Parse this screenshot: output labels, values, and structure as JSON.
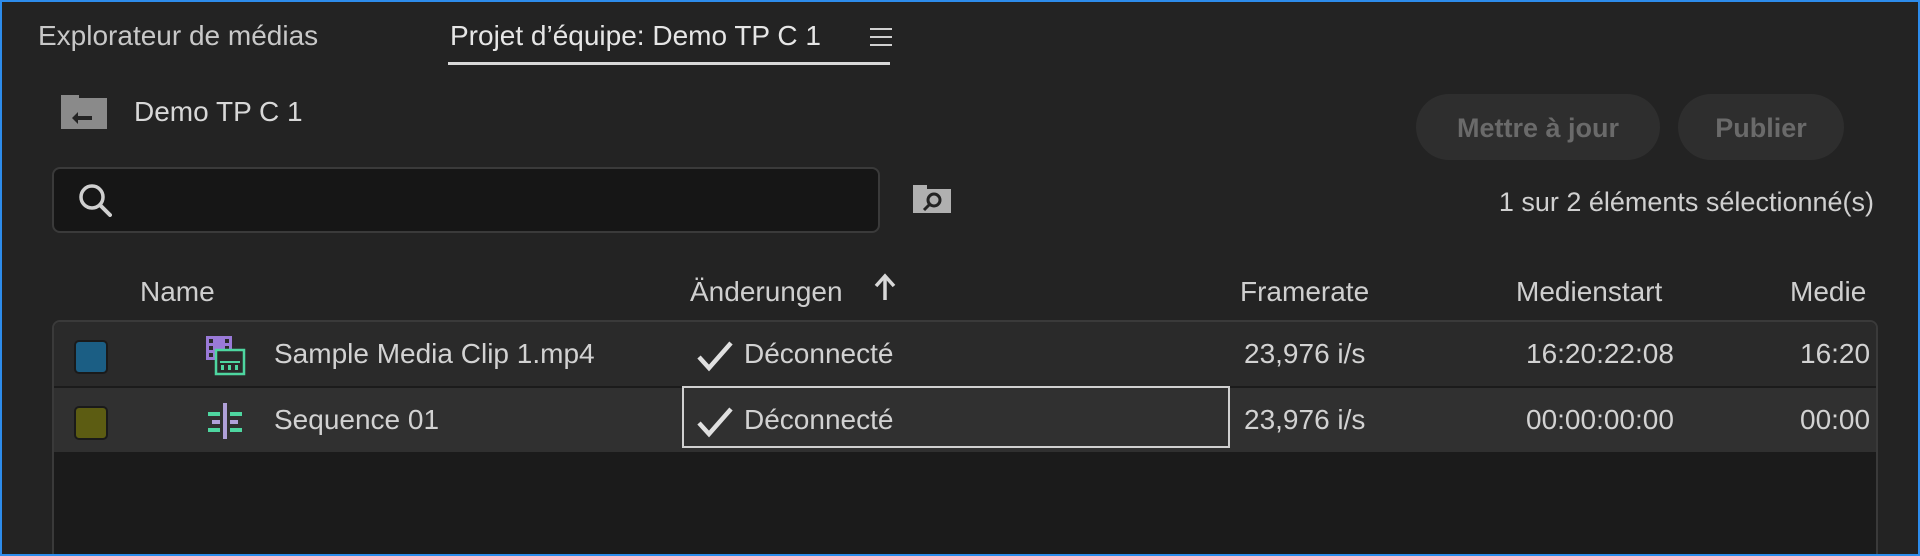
{
  "tabs": [
    {
      "label": "Explorateur de médias"
    },
    {
      "label": "Projet d’équipe: Demo TP C 1"
    }
  ],
  "project": {
    "name": "Demo TP C 1"
  },
  "buttons": {
    "update": "Mettre à jour",
    "publish": "Publier"
  },
  "search": {
    "value": "",
    "placeholder": ""
  },
  "status": {
    "selection": "1 sur 2 éléments sélectionné(s)"
  },
  "columns": {
    "name": "Name",
    "changes": "Änderungen",
    "framerate": "Framerate",
    "medienstart": "Medienstart",
    "medienende": "Medie"
  },
  "rows": [
    {
      "name": "Sample Media Clip 1.mp4",
      "status": "Déconnecté",
      "framerate": "23,976 i/s",
      "medienstart": "16:20:22:08",
      "medienende": "16:20",
      "label_color": "#1b5e84",
      "icon": "video-clip-icon"
    },
    {
      "name": "Sequence 01",
      "status": "Déconnecté",
      "framerate": "23,976 i/s",
      "medienstart": "00:00:00:00",
      "medienende": "00:00",
      "label_color": "#5c5c12",
      "icon": "sequence-icon"
    }
  ],
  "colors": {
    "accent_border": "#2d8ceb",
    "panel_bg": "#232323"
  }
}
